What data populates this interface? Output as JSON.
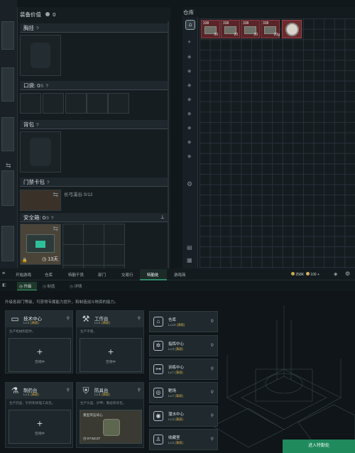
{
  "equip": {
    "value_label": "装备价值",
    "value": "0",
    "chest_label": "胸挂",
    "pocket_label": "口袋:",
    "pocket_count": "0",
    "pocket_max": "/5",
    "backpack_label": "背包",
    "keycard_label": "门禁卡包",
    "keycard_range": "长弓溪谷 0/12",
    "safebox_label": "安全箱:",
    "safebox_count": "0",
    "safebox_max": "/9",
    "safebox_timer": "13天",
    "help": "?"
  },
  "warehouse": {
    "title": "仓库",
    "items": [
      {
        "top": "338",
        "bottom": "20"
      },
      {
        "top": "338",
        "bottom": "20"
      },
      {
        "top": "338",
        "bottom": "20"
      },
      {
        "top": "338",
        "bottom": "20"
      },
      {
        "top": "338",
        "bottom": "8"
      }
    ]
  },
  "nav": {
    "tabs": [
      "开始游戏",
      "仓库",
      "特勤干员",
      "部门",
      "交易行",
      "特勤处",
      "游戏商"
    ],
    "active": "特勤处",
    "currency_a": "258K",
    "currency_b": "100 +",
    "sub_tabs": [
      "升级",
      "制造",
      "详情"
    ]
  },
  "base": {
    "description": "升级各部门等级，可获得专属能力提升，和制造战斗物资的能力。",
    "idle": "空闲中",
    "cards": [
      {
        "name": "技术中心",
        "lv": "Lv.3",
        "tag": "(满级)",
        "note": "生产枪械和配件。",
        "icon": "computer-icon"
      },
      {
        "name": "工作台",
        "lv": "Lv.3",
        "tag": "(满级)",
        "note": "生产手雷。",
        "icon": "hammer-icon"
      },
      {
        "name": "制药台",
        "lv": "Lv.3",
        "tag": "(满级)",
        "note": "生产药品、针剂和修理工具包。",
        "icon": "microscope-icon"
      },
      {
        "name": "防具台",
        "lv": "Lv.3",
        "tag": "(满级)",
        "note": "生产头盔、护甲、胸挂和背包。",
        "icon": "armor-icon"
      }
    ],
    "armor_item": "重型突击背心",
    "armor_timer": "07:53:27",
    "right_cards": [
      {
        "name": "仓库",
        "lv": "Lv.10",
        "tag": "(满级)",
        "glyph": "⌂"
      },
      {
        "name": "指挥中心",
        "lv": "Lv.3",
        "tag": "(满级)",
        "glyph": "✲"
      },
      {
        "name": "训练中心",
        "lv": "Lv.7",
        "tag": "(满级)",
        "glyph": "⊶"
      },
      {
        "name": "靶场",
        "lv": "Lv.7",
        "tag": "(满级)",
        "glyph": "◎"
      },
      {
        "name": "潜水中心",
        "lv": "Lv.3",
        "tag": "(满级)",
        "glyph": "◉"
      },
      {
        "name": "收藏室",
        "lv": "Lv.2",
        "tag": "(满级)",
        "glyph": "♙"
      }
    ],
    "enter_button": "进入特勤处"
  }
}
